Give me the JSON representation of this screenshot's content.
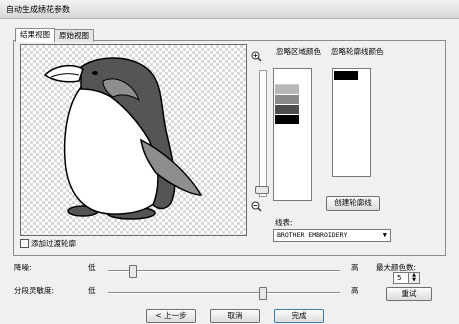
{
  "window": {
    "title": "自动生成绣花参数"
  },
  "tabs": [
    {
      "label": "结果视图",
      "active": true
    },
    {
      "label": "原始视图",
      "active": false
    }
  ],
  "preview": {
    "add_outline_label": "添加过渡轮廓",
    "add_outline_checked": false
  },
  "zoom": {
    "in_icon": "zoom-in-icon",
    "out_icon": "zoom-out-icon",
    "level": 0.05
  },
  "ignore_area_colors": {
    "label": "忽略区域颜色",
    "swatches": [
      "#ffffff",
      "#b7b7b7",
      "#8a8a8a",
      "#4d4d4d",
      "#000000"
    ]
  },
  "ignore_outline_colors": {
    "label": "忽略轮廓线颜色",
    "swatches": [
      "#000000"
    ]
  },
  "edit_outline_button": "创建轮廓线",
  "thread_chart": {
    "label": "线表:",
    "selected": "BROTHER EMBROIDERY"
  },
  "noise": {
    "label": "降噪:",
    "low": "低",
    "high": "高",
    "level": 0.1
  },
  "segmentation": {
    "label": "分段灵敏度:",
    "low": "低",
    "high": "高",
    "level": 0.63
  },
  "max_colors": {
    "label": "最大颜色数:",
    "value": "5"
  },
  "retry_button": "重试",
  "footer": {
    "back": "< 上一步",
    "cancel": "取消",
    "finish": "完成"
  },
  "colors": {
    "window_bg": "#f0f0f0",
    "penguin_dark": "#555555",
    "penguin_mid": "#8e8e8e",
    "penguin_light": "#ffffff"
  }
}
